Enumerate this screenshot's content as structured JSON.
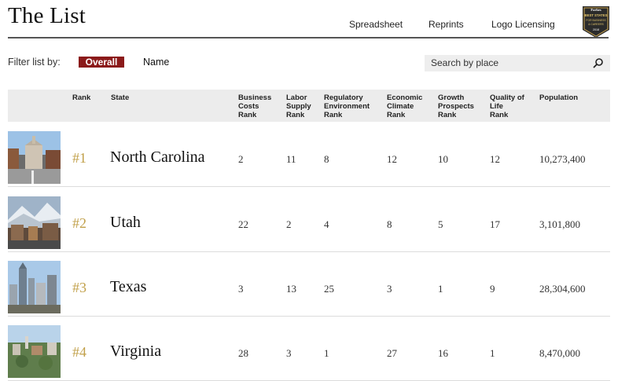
{
  "header": {
    "title": "The List",
    "links": [
      "Spreadsheet",
      "Reprints",
      "Logo Licensing"
    ],
    "badge": {
      "line1": "Forbes",
      "line2": "BEST STATES",
      "line3": "FOR BUSINESS",
      "line4": "& CAREERS",
      "year": "2018"
    }
  },
  "filter": {
    "label": "Filter list by:",
    "options": [
      "Overall",
      "Name"
    ],
    "selected": "Overall"
  },
  "search": {
    "placeholder": "Search by place"
  },
  "table": {
    "columns": [
      "Rank",
      "State",
      "Business\nCosts\nRank",
      "Labor\nSupply\nRank",
      "Regulatory\nEnvironment\nRank",
      "Economic\nClimate\nRank",
      "Growth\nProspects\nRank",
      "Quality of\nLife\nRank",
      "Population"
    ],
    "rows": [
      {
        "rank": "#1",
        "state": "North Carolina",
        "business_costs": "2",
        "labor_supply": "11",
        "regulatory": "8",
        "economic": "12",
        "growth": "10",
        "quality": "12",
        "population": "10,273,400"
      },
      {
        "rank": "#2",
        "state": "Utah",
        "business_costs": "22",
        "labor_supply": "2",
        "regulatory": "4",
        "economic": "8",
        "growth": "5",
        "quality": "17",
        "population": "3,101,800"
      },
      {
        "rank": "#3",
        "state": "Texas",
        "business_costs": "3",
        "labor_supply": "13",
        "regulatory": "25",
        "economic": "3",
        "growth": "1",
        "quality": "9",
        "population": "28,304,600"
      },
      {
        "rank": "#4",
        "state": "Virginia",
        "business_costs": "28",
        "labor_supply": "3",
        "regulatory": "1",
        "economic": "27",
        "growth": "16",
        "quality": "1",
        "population": "8,470,000"
      }
    ]
  },
  "colors": {
    "accent": "#8b1a1a",
    "rank_gold": "#c1a04a",
    "header_bg": "#ececec",
    "search_bg": "#eeeeee"
  },
  "icons": {
    "search": "magnifier-icon"
  }
}
